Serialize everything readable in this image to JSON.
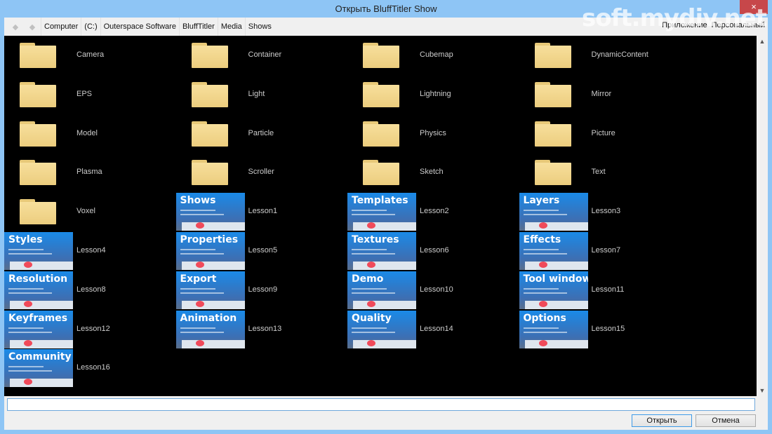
{
  "window": {
    "title": "Открыть BluffTitler Show",
    "close_icon": "×",
    "watermark": "soft.mydiv.net"
  },
  "toolbar": {
    "back_icon": "◆",
    "forward_icon": "◆",
    "breadcrumb": [
      "Computer",
      "(C:)",
      "Outerspace Software",
      "BluffTitler",
      "Media",
      "Shows"
    ],
    "right_tabs": [
      "Приложение",
      "Персональный"
    ]
  },
  "items": [
    {
      "label": "Camera",
      "type": "folder"
    },
    {
      "label": "Container",
      "type": "folder"
    },
    {
      "label": "Cubemap",
      "type": "folder"
    },
    {
      "label": "DynamicContent",
      "type": "folder"
    },
    {
      "label": "EPS",
      "type": "folder"
    },
    {
      "label": "Light",
      "type": "folder"
    },
    {
      "label": "Lightning",
      "type": "folder"
    },
    {
      "label": "Mirror",
      "type": "folder"
    },
    {
      "label": "Model",
      "type": "folder"
    },
    {
      "label": "Particle",
      "type": "folder"
    },
    {
      "label": "Physics",
      "type": "folder"
    },
    {
      "label": "Picture",
      "type": "folder"
    },
    {
      "label": "Plasma",
      "type": "folder"
    },
    {
      "label": "Scroller",
      "type": "folder"
    },
    {
      "label": "Sketch",
      "type": "folder"
    },
    {
      "label": "Text",
      "type": "folder"
    },
    {
      "label": "Voxel",
      "type": "folder"
    },
    {
      "label": "Lesson1",
      "type": "show",
      "thumb_title": "Shows"
    },
    {
      "label": "Lesson2",
      "type": "show",
      "thumb_title": "Templates"
    },
    {
      "label": "Lesson3",
      "type": "show",
      "thumb_title": "Layers"
    },
    {
      "label": "Lesson4",
      "type": "show",
      "thumb_title": "Styles"
    },
    {
      "label": "Lesson5",
      "type": "show",
      "thumb_title": "Properties"
    },
    {
      "label": "Lesson6",
      "type": "show",
      "thumb_title": "Textures"
    },
    {
      "label": "Lesson7",
      "type": "show",
      "thumb_title": "Effects"
    },
    {
      "label": "Lesson8",
      "type": "show",
      "thumb_title": "Resolution"
    },
    {
      "label": "Lesson9",
      "type": "show",
      "thumb_title": "Export"
    },
    {
      "label": "Lesson10",
      "type": "show",
      "thumb_title": "Demo"
    },
    {
      "label": "Lesson11",
      "type": "show",
      "thumb_title": "Tool window"
    },
    {
      "label": "Lesson12",
      "type": "show",
      "thumb_title": "Keyframes"
    },
    {
      "label": "Lesson13",
      "type": "show",
      "thumb_title": "Animation"
    },
    {
      "label": "Lesson14",
      "type": "show",
      "thumb_title": "Quality"
    },
    {
      "label": "Lesson15",
      "type": "show",
      "thumb_title": "Options"
    },
    {
      "label": "Lesson16",
      "type": "show",
      "thumb_title": "Community"
    }
  ],
  "scrollbar": {
    "up_icon": "▲",
    "down_icon": "▼"
  },
  "filename": {
    "value": ""
  },
  "buttons": {
    "open": "Открыть",
    "cancel": "Отмена"
  }
}
